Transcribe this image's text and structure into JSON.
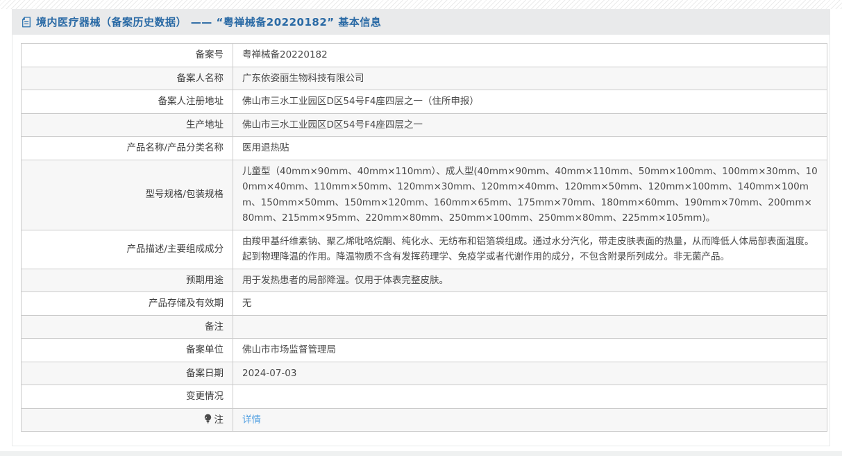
{
  "header": {
    "icon": "document-icon",
    "title": "境内医疗器械（备案历史数据） —— “粤禅械备20220182” 基本信息"
  },
  "colors": {
    "title_blue": "#2a6aa5",
    "link_blue": "#52a0e2",
    "title_bar_bg": "#e9eaeb",
    "zebra_row_bg": "#f7f7f7",
    "table_border": "#cbcbcb"
  },
  "table": {
    "rows": [
      {
        "label": "备案号",
        "value": "粤禅械备20220182"
      },
      {
        "label": "备案人名称",
        "value": "广东依姿丽生物科技有限公司"
      },
      {
        "label": "备案人注册地址",
        "value": "佛山市三水工业园区D区54号F4座四层之一（住所申报）"
      },
      {
        "label": "生产地址",
        "value": "佛山市三水工业园区D区54号F4座四层之一"
      },
      {
        "label": "产品名称/产品分类名称",
        "value": "医用退热贴"
      },
      {
        "label": "型号规格/包装规格",
        "value": "儿童型（40mm×90mm、40mm×110mm）、成人型(40mm×90mm、40mm×110mm、50mm×100mm、100mm×30mm、100mm×40mm、110mm×50mm、120mm×30mm、120mm×40mm、120mm×50mm、120mm×100mm、140mm×100mm、150mm×50mm、150mm×120mm、160mm×65mm、175mm×70mm、180mm×60mm、190mm×70mm、200mm×80mm、215mm×95mm、220mm×80mm、250mm×100mm、250mm×80mm、225mm×105mm)。"
      },
      {
        "label": "产品描述/主要组成成分",
        "value": "由羧甲基纤维素钠、聚乙烯吡咯烷酮、纯化水、无纺布和铝箔袋组成。通过水分汽化，带走皮肤表面的热量，从而降低人体局部表面温度。起到物理降温的作用。降温物质不含有发挥药理学、免疫学或者代谢作用的成分，不包含附录所列成分。非无菌产品。"
      },
      {
        "label": "预期用途",
        "value": "用于发热患者的局部降温。仅用于体表完整皮肤。"
      },
      {
        "label": "产品存储及有效期",
        "value": "无"
      },
      {
        "label": "备注",
        "value": ""
      },
      {
        "label": "备案单位",
        "value": "佛山市市场监督管理局"
      },
      {
        "label": "备案日期",
        "value": "2024-07-03"
      },
      {
        "label": "变更情况",
        "value": ""
      },
      {
        "label": "注",
        "value": "",
        "note_icon": true,
        "link": "详情"
      }
    ]
  }
}
